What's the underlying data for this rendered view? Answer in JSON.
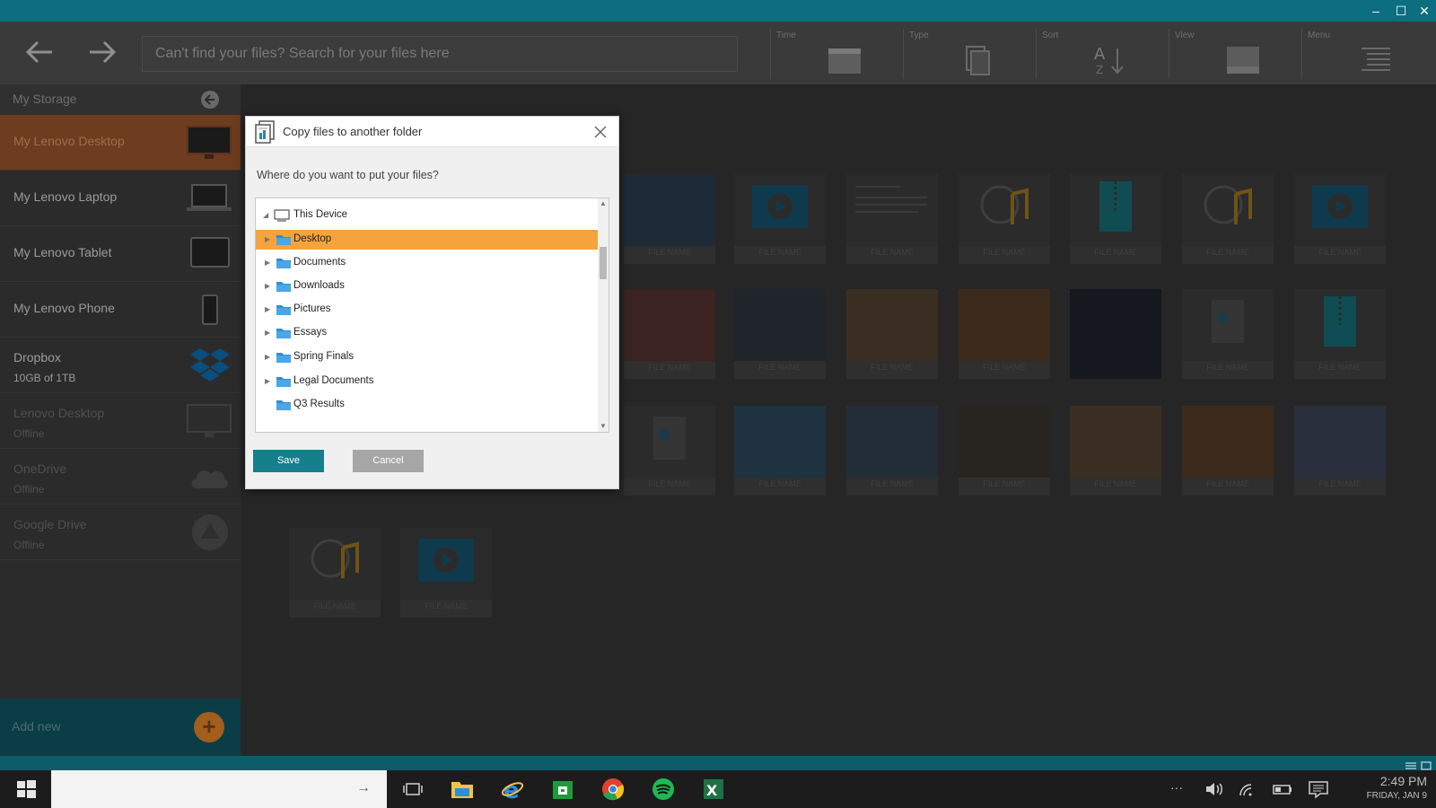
{
  "window": {
    "minimize": "–",
    "maximize": "☐",
    "close": "✕"
  },
  "toolbar": {
    "search_placeholder": "Can't find your files? Search for your files here",
    "groups": [
      {
        "label": "Time",
        "icon": "time-view-icon"
      },
      {
        "label": "Type",
        "icon": "type-icon"
      },
      {
        "label": "Sort",
        "icon": "sort-az-icon"
      },
      {
        "label": "View",
        "icon": "view-icon"
      },
      {
        "label": "Menu",
        "icon": "menu-list-icon"
      }
    ]
  },
  "sidebar": {
    "header": "My Storage",
    "items": [
      {
        "label": "My Lenovo Desktop",
        "sub": "",
        "icon": "desktop-icon"
      },
      {
        "label": "My Lenovo Laptop",
        "sub": "",
        "icon": "laptop-icon"
      },
      {
        "label": "My Lenovo Tablet",
        "sub": "",
        "icon": "tablet-icon"
      },
      {
        "label": "My Lenovo Phone",
        "sub": "",
        "icon": "phone-icon"
      },
      {
        "label": "Dropbox",
        "sub": "10GB of 1TB",
        "icon": "dropbox-icon"
      },
      {
        "label": "Lenovo Desktop",
        "sub": "Offline",
        "icon": "desktop-icon"
      },
      {
        "label": "OneDrive",
        "sub": "Offline",
        "icon": "onedrive-icon"
      },
      {
        "label": "Google Drive",
        "sub": "Offline",
        "icon": "google-drive-icon"
      }
    ],
    "add_new": "Add new"
  },
  "grid": {
    "file_name_label": "FILE NAME"
  },
  "dialog": {
    "title": "Copy files to another folder",
    "question": "Where do you want to put your files?",
    "tree": [
      {
        "label": "This Device",
        "expanded": true,
        "selected": false
      },
      {
        "label": "Desktop",
        "expanded": false,
        "selected": true
      },
      {
        "label": "Documents",
        "expanded": false,
        "selected": false
      },
      {
        "label": "Downloads",
        "expanded": false,
        "selected": false
      },
      {
        "label": "Pictures",
        "expanded": false,
        "selected": false
      },
      {
        "label": "Essays",
        "expanded": false,
        "selected": false
      },
      {
        "label": "Spring Finals",
        "expanded": false,
        "selected": false
      },
      {
        "label": "Legal Documents",
        "expanded": false,
        "selected": false
      },
      {
        "label": "Q3 Results",
        "expanded": false,
        "selected": false
      }
    ],
    "save_label": "Save",
    "cancel_label": "Cancel"
  },
  "taskbar": {
    "search_arrow": "→",
    "ellipsis": "···",
    "time": "2:49 PM",
    "date": "FRIDAY, JAN 9"
  },
  "colors": {
    "accent_teal": "#157f8c",
    "selection_orange": "#f5a33c",
    "title_bar": "#0c6e7f"
  }
}
